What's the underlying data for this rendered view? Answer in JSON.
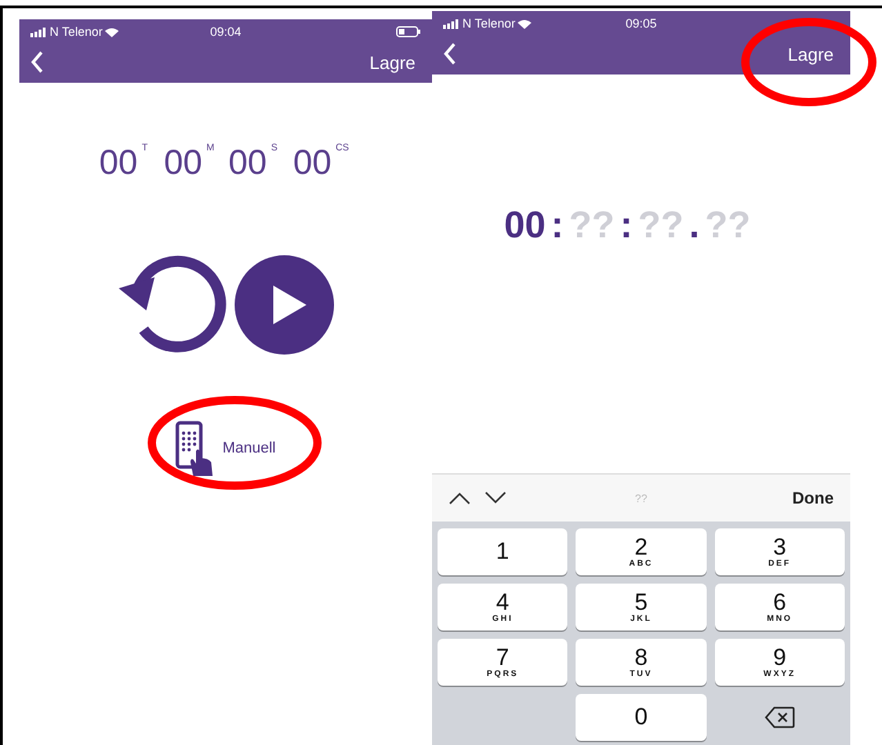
{
  "left_screen": {
    "status_bar": {
      "carrier": "N Telenor",
      "time": "09:04"
    },
    "nav_bar": {
      "action": "Lagre"
    },
    "timer": [
      {
        "value": "00",
        "unit": "T"
      },
      {
        "value": "00",
        "unit": "M"
      },
      {
        "value": "00",
        "unit": "S"
      },
      {
        "value": "00",
        "unit": "CS"
      }
    ],
    "manual_button": {
      "label": "Manuell"
    }
  },
  "right_screen": {
    "status_bar": {
      "carrier": "N Telenor",
      "time": "09:05"
    },
    "nav_bar": {
      "action": "Lagre"
    },
    "entry": [
      {
        "text": "00",
        "filled": true
      },
      {
        "text": ":",
        "filled": true
      },
      {
        "text": "??",
        "filled": false
      },
      {
        "text": ":",
        "filled": true
      },
      {
        "text": "??",
        "filled": false
      },
      {
        "text": ".",
        "filled": true
      },
      {
        "text": "??",
        "filled": false
      }
    ],
    "keyboard": {
      "placeholder": "??",
      "done": "Done",
      "keys": [
        {
          "kind": "digit",
          "digit": "1"
        },
        {
          "kind": "digit",
          "digit": "2",
          "letters": "ABC"
        },
        {
          "kind": "digit",
          "digit": "3",
          "letters": "DEF"
        },
        {
          "kind": "digit",
          "digit": "4",
          "letters": "GHI"
        },
        {
          "kind": "digit",
          "digit": "5",
          "letters": "JKL"
        },
        {
          "kind": "digit",
          "digit": "6",
          "letters": "MNO"
        },
        {
          "kind": "digit",
          "digit": "7",
          "letters": "PQRS"
        },
        {
          "kind": "digit",
          "digit": "8",
          "letters": "TUV"
        },
        {
          "kind": "digit",
          "digit": "9",
          "letters": "WXYZ"
        },
        {
          "kind": "blank"
        },
        {
          "kind": "digit",
          "digit": "0"
        },
        {
          "kind": "delete"
        }
      ]
    }
  }
}
